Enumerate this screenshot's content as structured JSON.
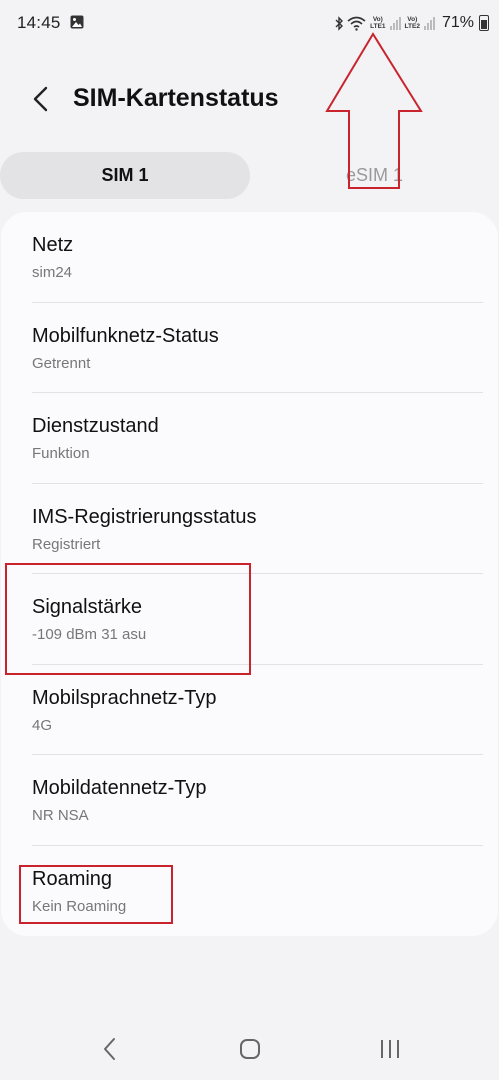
{
  "status_bar": {
    "time": "14:45",
    "sim1_badge": {
      "top": "Vo)",
      "bottom": "LTE1"
    },
    "sim2_badge": {
      "top": "Vo)",
      "bottom": "LTE2"
    },
    "battery": "71%",
    "icons": [
      "image-icon",
      "bluetooth-icon",
      "wifi-icon",
      "signal-icon",
      "battery-icon"
    ]
  },
  "header": {
    "title": "SIM-Kartenstatus"
  },
  "tabs": [
    {
      "label": "SIM 1",
      "selected": true
    },
    {
      "label": "eSIM 1",
      "selected": false
    }
  ],
  "rows": [
    {
      "label": "Netz",
      "value": "sim24"
    },
    {
      "label": "Mobilfunknetz-Status",
      "value": "Getrennt"
    },
    {
      "label": "Dienstzustand",
      "value": "Funktion"
    },
    {
      "label": "IMS-Registrierungsstatus",
      "value": "Registriert"
    },
    {
      "label": "Signalstärke",
      "value": "-109 dBm 31 asu"
    },
    {
      "label": "Mobilsprachnetz-Typ",
      "value": "4G"
    },
    {
      "label": "Mobildatennetz-Typ",
      "value": "NR NSA"
    },
    {
      "label": "Roaming",
      "value": "Kein Roaming"
    }
  ],
  "colors": {
    "background": "#f3f3f5",
    "card": "#fbfbfd",
    "active_tab": "#e3e3e6",
    "annotation": "#c9242e",
    "secondary_text": "#777777"
  }
}
